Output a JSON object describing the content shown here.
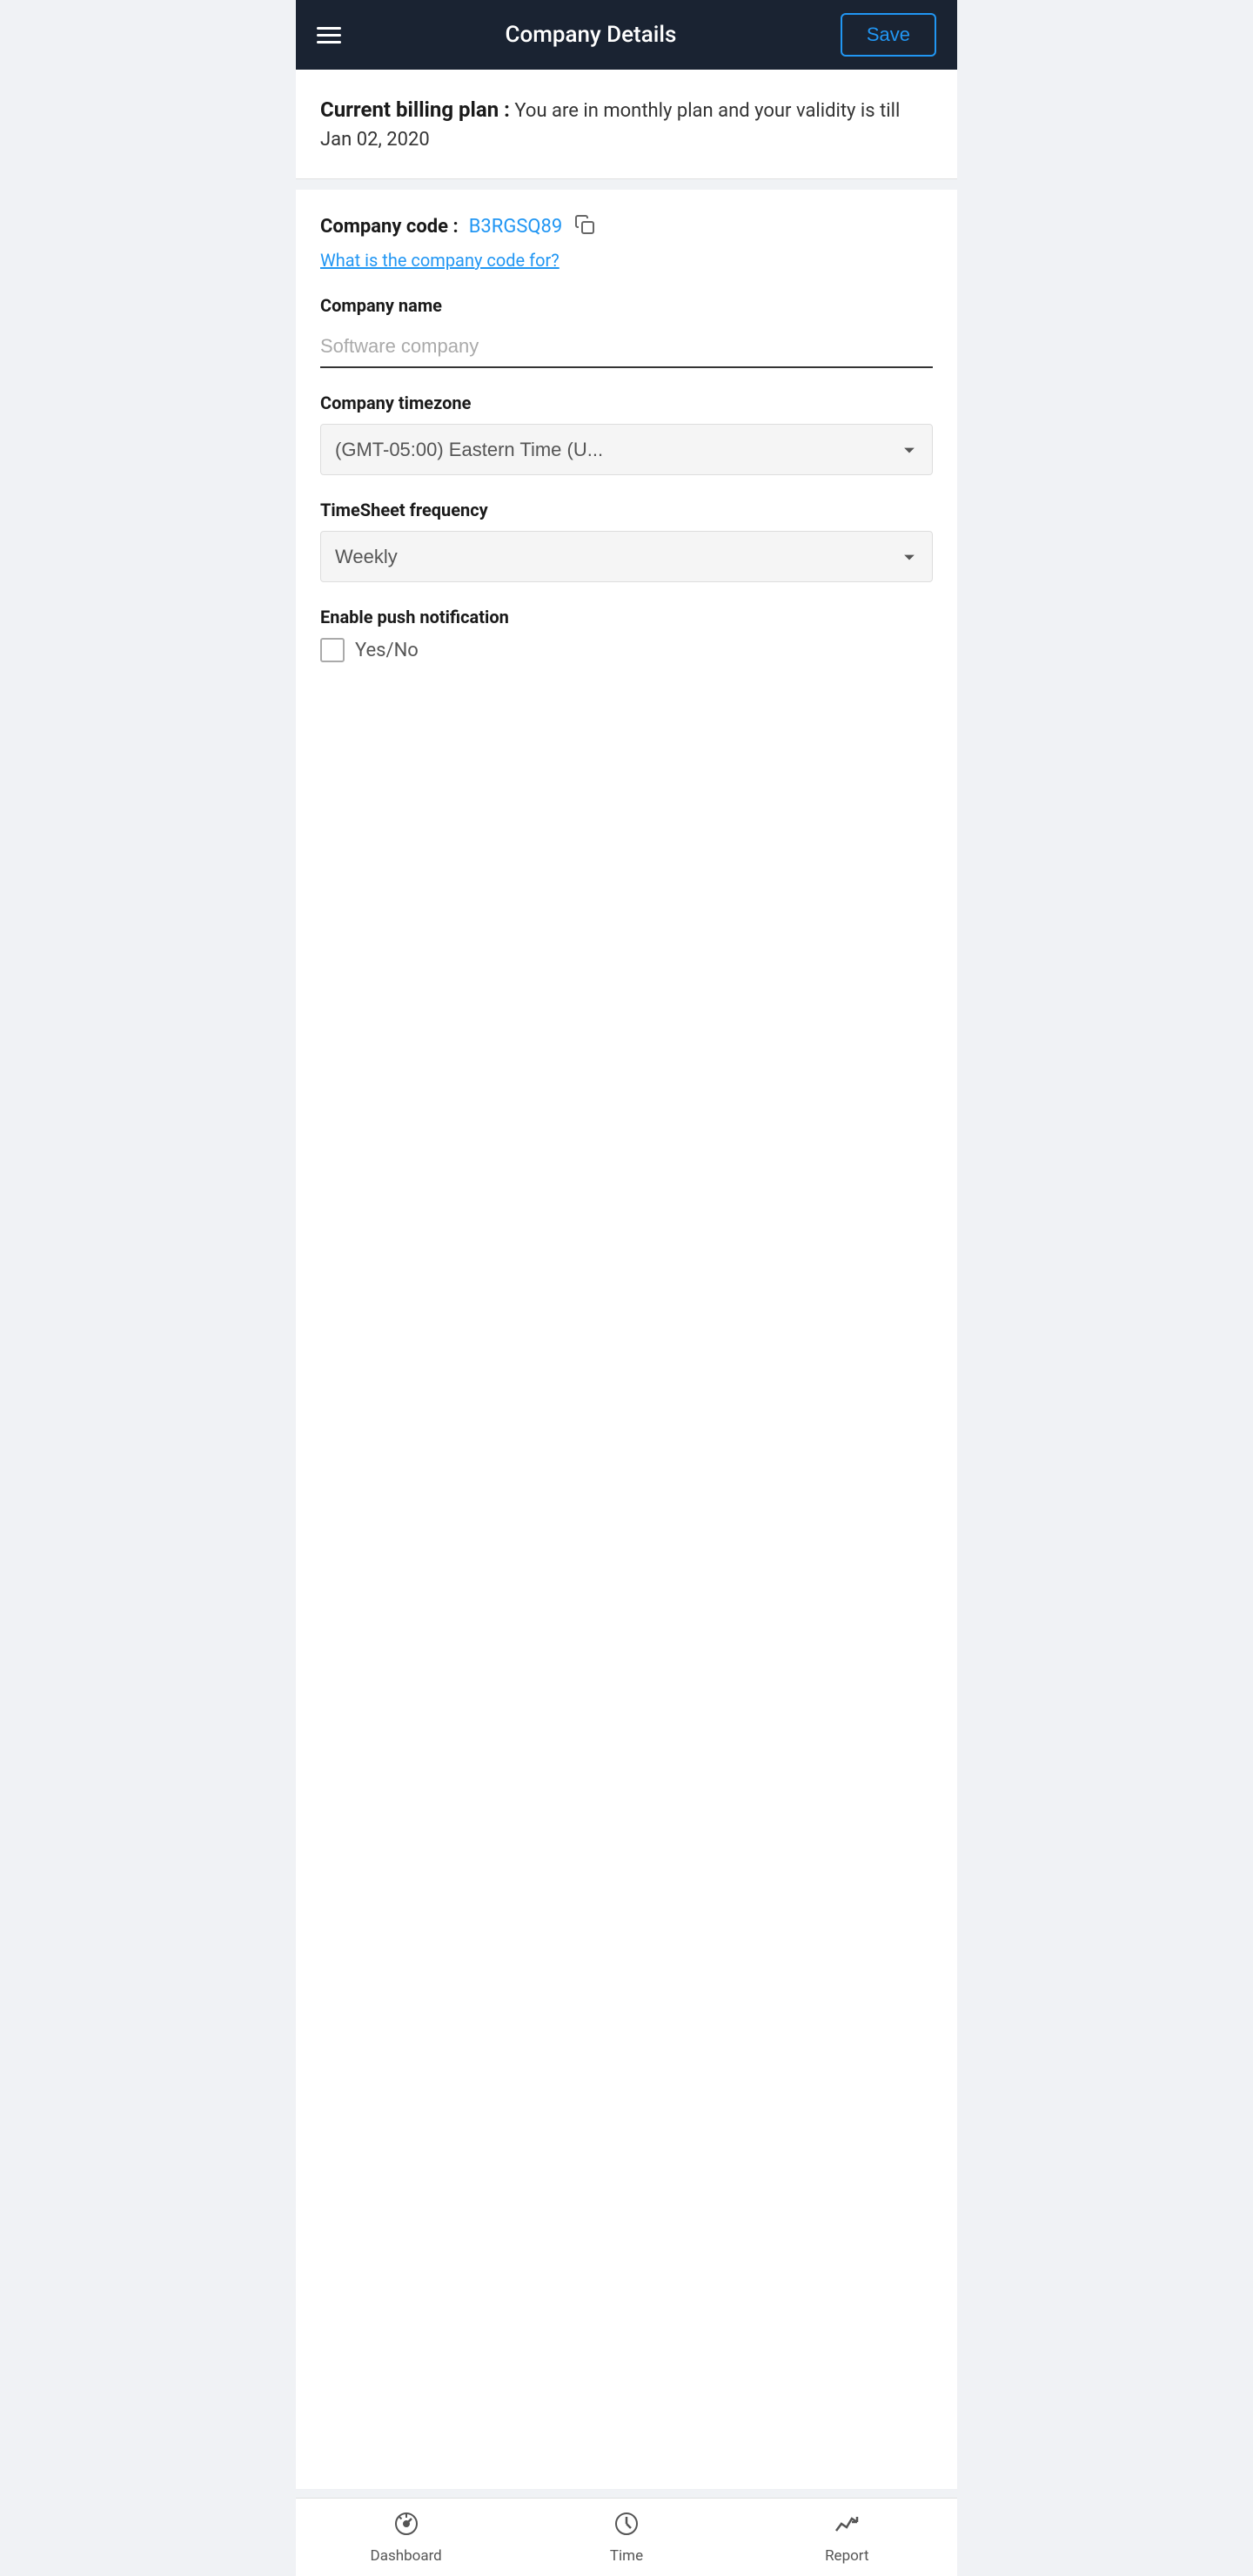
{
  "header": {
    "title": "Company Details",
    "save_button_label": "Save"
  },
  "billing": {
    "label": "Current billing plan :",
    "description": "You are in monthly plan and your validity is till Jan 02, 2020"
  },
  "company_code": {
    "label": "Company code :",
    "value": "B3RGSQ89",
    "link_text": "What is the company code for?"
  },
  "form": {
    "company_name_label": "Company name",
    "company_name_placeholder": "Software company",
    "company_timezone_label": "Company timezone",
    "company_timezone_value": "(GMT-05:00) Eastern Time (U...",
    "timesheet_frequency_label": "TimeSheet frequency",
    "timesheet_frequency_value": "Weekly",
    "push_notification_label": "Enable push notification",
    "checkbox_label": "Yes/No"
  },
  "bottom_nav": {
    "dashboard_label": "Dashboard",
    "time_label": "Time",
    "report_label": "Report"
  },
  "icons": {
    "menu": "☰",
    "copy": "⧉",
    "dashboard": "dashboard-icon",
    "time": "time-icon",
    "report": "report-icon"
  }
}
